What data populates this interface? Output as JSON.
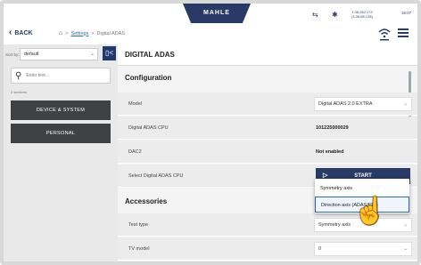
{
  "status": {
    "brand": "MAHLE",
    "network_icon": "network-icon",
    "bluetooth_icon": "bluetooth-icon",
    "ip_line1": "1.35.282.173",
    "ip_line2": "(1.35.66.128)",
    "time": "16:07"
  },
  "nav": {
    "back_label": "BACK",
    "crumb_link": "Settings",
    "crumb_sep": ">",
    "crumb_current": "Digital ADAS"
  },
  "sidebar": {
    "sort_label": "Sort by:",
    "sort_value": "default",
    "collapse_glyph": "▯<",
    "search_placeholder": "Enter text...",
    "sections_count": "2 sections",
    "items": [
      {
        "label": "DEVICE & SYSTEM"
      },
      {
        "label": "PERSONAL"
      }
    ]
  },
  "main": {
    "title": "DIGITAL ADAS",
    "configuration": {
      "title": "Configuration",
      "model_label": "Model",
      "model_value": "Digital ADAS 2.0 EXTRA",
      "cpu_label": "Digital ADAS CPU",
      "cpu_value": "101225000029",
      "dac_label": "DAC2",
      "dac_value": "Not enabled",
      "select_cpu_label": "Select Digital ADAS CPU",
      "start_label": "START"
    },
    "accessories": {
      "title": "Accessories",
      "test_type_label": "Test type",
      "test_type_value": "Symmetry axis",
      "tv_model_label": "TV model",
      "tv_model_value": "0"
    }
  },
  "dropdown": {
    "options": [
      {
        "label": "Symmetry axis",
        "selected": false
      },
      {
        "label": "Direction axis (ADAS/EVI)",
        "selected": true
      }
    ]
  },
  "colors": {
    "brand_navy": "#283a66",
    "sidebar_button": "#404142",
    "link": "#2b6cb0"
  }
}
